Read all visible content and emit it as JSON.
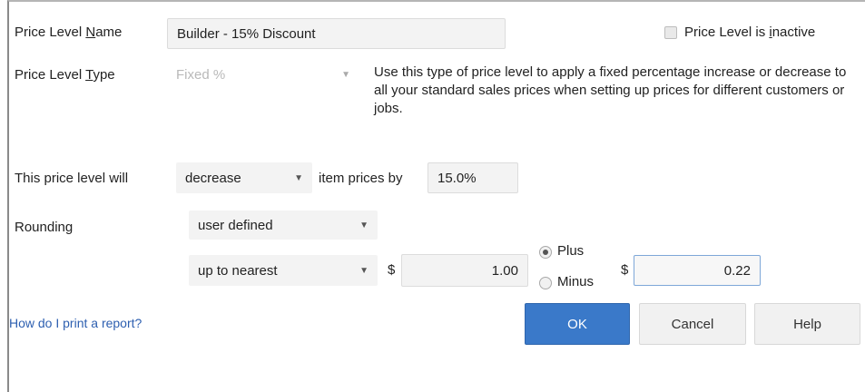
{
  "form": {
    "name_label_pre": "Price Level ",
    "name_label_accel": "N",
    "name_label_post": "ame",
    "name_value": "Builder - 15% Discount",
    "inactive_label_pre": "Price Level is ",
    "inactive_label_accel": "i",
    "inactive_label_post": "nactive",
    "type_label_pre": "Price Level ",
    "type_label_accel": "T",
    "type_label_post": "ype",
    "type_value": "Fixed %",
    "type_description": "Use this type of price level to apply a fixed percentage increase or decrease to all your standard sales prices when setting up prices for different customers or jobs.",
    "will_label": "This price level will",
    "direction_value": "decrease",
    "item_prices_label": "item prices by",
    "percent_value": "15.0%",
    "rounding_label": "Rounding",
    "rounding_value": "user defined",
    "round_method_value": "up to nearest",
    "currency_symbol": "$",
    "round_amount": "1.00",
    "plus_label": "Plus",
    "minus_label": "Minus",
    "currency_symbol_2": "$",
    "adjust_amount": "0.22",
    "plus_selected": true
  },
  "footer": {
    "help_link": "How do I print a report?",
    "ok_label": "OK",
    "cancel_label": "Cancel",
    "help_label": "Help"
  },
  "colors": {
    "primary_button": "#3a79c9",
    "link": "#2d5fb0"
  }
}
